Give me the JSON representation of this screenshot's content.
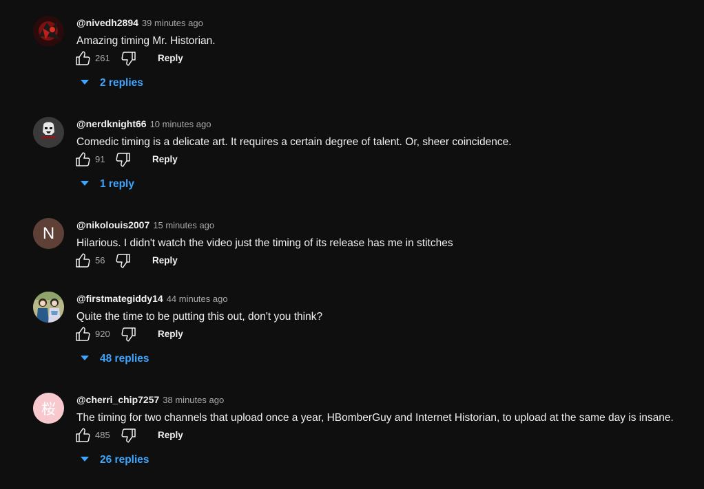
{
  "reply_label": "Reply",
  "colors": {
    "background": "#0f0f0f",
    "text": "#f1f1f1",
    "meta": "#aaaaaa",
    "link_blue": "#3ea6ff"
  },
  "comments": [
    {
      "author": "@nivedh2894",
      "time": "39 minutes ago",
      "text": "Amazing timing Mr. Historian.",
      "likes": "261",
      "replies": "2 replies",
      "avatar": "dark-red-artwork"
    },
    {
      "author": "@nerdknight66",
      "time": "10 minutes ago",
      "text": "Comedic timing is a delicate art. It requires a certain degree of talent. Or, sheer coincidence.",
      "likes": "91",
      "replies": "1 reply",
      "avatar": "stormtrooper-helmet"
    },
    {
      "author": "@nikolouis2007",
      "time": "15 minutes ago",
      "text": "Hilarious. I didn't watch the video just the timing of its release has me in stitches",
      "likes": "56",
      "avatar": "letter",
      "avatar_letter": "N"
    },
    {
      "author": "@firstmategiddy14",
      "time": "44 minutes ago",
      "text": "Quite the time to be putting this out, don't you think?",
      "likes": "920",
      "replies": "48 replies",
      "avatar": "anime-figures"
    },
    {
      "author": "@cherri_chip7257",
      "time": "38 minutes ago",
      "text": "The timing for two channels that upload once a year, HBomberGuy and Internet Historian, to upload at the same day is insane.",
      "likes": "485",
      "replies": "26 replies",
      "avatar": "letter",
      "avatar_letter": "桜"
    }
  ]
}
